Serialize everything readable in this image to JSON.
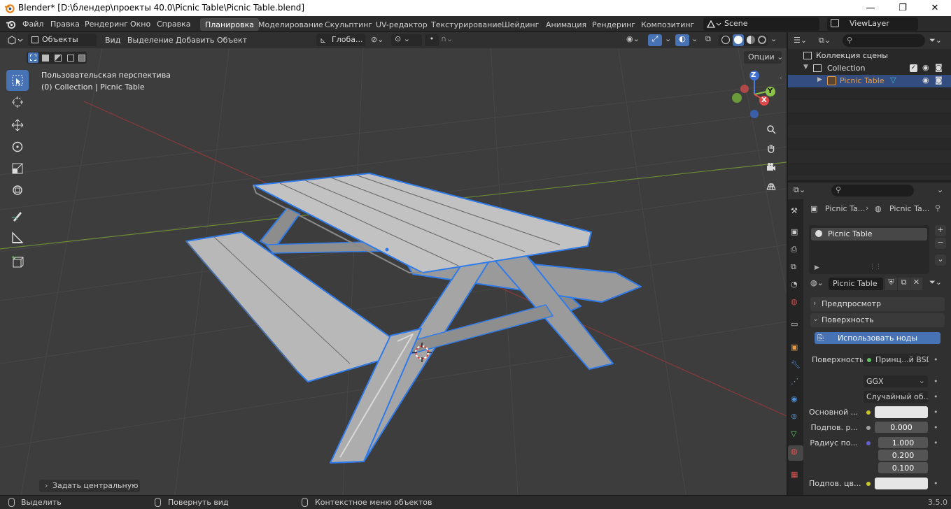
{
  "window": {
    "title": "Blender* [D:\\блендер\\проекты 40.0\\Picnic Table\\Picnic Table.blend]",
    "minimize": "—",
    "maximize": "❐",
    "close": "✕"
  },
  "menu": {
    "items": [
      "Файл",
      "Правка",
      "Рендеринг",
      "Окно",
      "Справка"
    ]
  },
  "workspaces": [
    "Планировка",
    "Моделирование",
    "Скульптинг",
    "UV-редактор",
    "Текстурирование",
    "Шейдинг",
    "Анимация",
    "Рендеринг",
    "Композитинг"
  ],
  "active_workspace": "Планировка",
  "scene": {
    "name": "Scene",
    "view_layer": "ViewLayer"
  },
  "viewport_header": {
    "mode": "Объекты",
    "menus": [
      "Вид",
      "Выделение",
      "Добавить",
      "Объект"
    ],
    "orientation": "Глоба...",
    "options": "Опции"
  },
  "viewport": {
    "perspective_label": "Пользовательская перспектива",
    "collection_label": "(0) Collection | Picnic Table",
    "gizmo": {
      "z": "Z",
      "y": "Y",
      "x": "X"
    },
    "last_op": "Задать центральную точк"
  },
  "outliner": {
    "root": "Коллекция сцены",
    "collection": "Collection",
    "object": "Picnic Table"
  },
  "properties": {
    "breadcrumb_object": "Picnic Ta...",
    "breadcrumb_material": "Picnic Ta...",
    "material_slot": "Picnic Table",
    "material_name": "Picnic Table",
    "panel_preview": "Предпросмотр",
    "panel_surface": "Поверхность",
    "use_nodes": "Использовать ноды",
    "surface_label": "Поверхность",
    "surface_value": "Принц...й BSDF",
    "distribution": "GGX",
    "subsurface_method": "Случайный об...",
    "base_color_label": "Основной ...",
    "subsurface_label": "Подпов. р...",
    "subsurface_value": "0.000",
    "radius_label": "Радиус по...",
    "radius_values": [
      "1.000",
      "0.200",
      "0.100"
    ],
    "subsurface_color_label": "Подпов. цв..."
  },
  "status": {
    "select": "Выделить",
    "rotate": "Повернуть вид",
    "context": "Контекстное меню объектов",
    "version": "3.5.0"
  },
  "colors": {
    "accent": "#4772b3",
    "selection_outline": "#2f7bea",
    "active_object": "#e89a3c"
  }
}
